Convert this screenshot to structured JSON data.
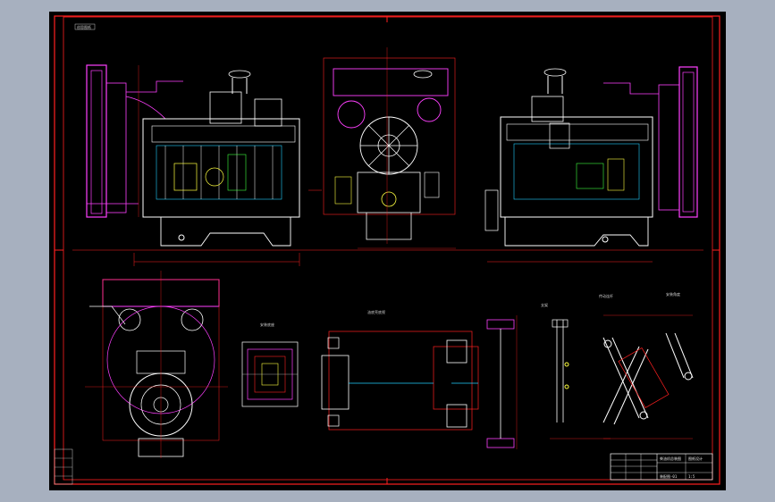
{
  "drawing": {
    "corner_tag": "创思图纸",
    "detail_a_label": "安装底座",
    "detail_b_label": "油底壳底视",
    "bracket_label": "支架",
    "linkage_label_1": "传动连杆",
    "linkage_label_2": "安装角度",
    "title_block": {
      "drawing_name": "柴油机总装图",
      "company": "图纸设计",
      "drawing_no": "装配图-01",
      "scale": "1:5"
    }
  },
  "colors": {
    "frame": "#ff2020",
    "magenta": "#ff40ff",
    "white": "#ffffff",
    "cyan": "#20d0ff",
    "yellow": "#ffff40",
    "green": "#40ff40",
    "blue": "#4060ff",
    "grey": "#c8c8c8"
  }
}
